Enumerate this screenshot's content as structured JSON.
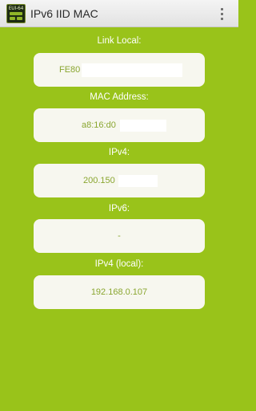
{
  "app": {
    "icon_text": "EUI-64",
    "title": "IPv6 IID MAC",
    "overflow_icon": "vertical-dots-icon"
  },
  "fields": [
    {
      "label": "Link Local:",
      "value": "FE80"
    },
    {
      "label": "MAC Address:",
      "value": "a8:16:d0"
    },
    {
      "label": "IPv4:",
      "value": "200.150"
    },
    {
      "label": "IPv6:",
      "value": "-"
    },
    {
      "label": "IPv4 (local):",
      "value": "192.168.0.107"
    }
  ],
  "colors": {
    "background": "#99c31a",
    "card": "#f7f7ef",
    "value_text": "#8aa630",
    "label_text": "#ffffff"
  }
}
